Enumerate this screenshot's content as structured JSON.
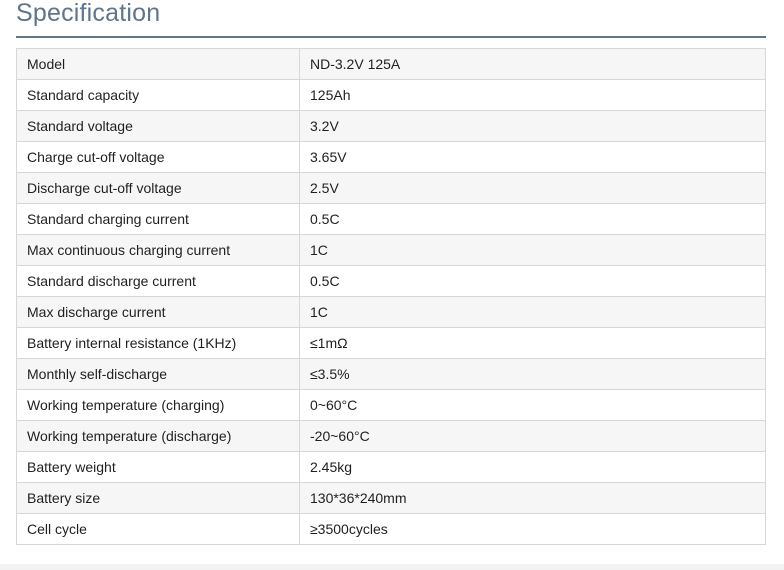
{
  "heading": "Specification",
  "rows": [
    {
      "parameter": "Model",
      "value": "ND-3.2V 125A"
    },
    {
      "parameter": "Standard capacity",
      "value": "125Ah"
    },
    {
      "parameter": "Standard voltage",
      "value": "3.2V"
    },
    {
      "parameter": "Charge cut-off voltage",
      "value": "3.65V"
    },
    {
      "parameter": "Discharge cut-off voltage",
      "value": "2.5V"
    },
    {
      "parameter": "Standard charging current",
      "value": "0.5C"
    },
    {
      "parameter": "Max continuous charging current",
      "value": "1C"
    },
    {
      "parameter": "Standard discharge current",
      "value": "0.5C"
    },
    {
      "parameter": "Max discharge current",
      "value": "1C"
    },
    {
      "parameter": "Battery internal resistance (1KHz)",
      "value": "≤1mΩ"
    },
    {
      "parameter": "Monthly self-discharge",
      "value": "≤3.5%"
    },
    {
      "parameter": "Working temperature (charging)",
      "value": "0~60°C"
    },
    {
      "parameter": "Working temperature (discharge)",
      "value": "-20~60°C"
    },
    {
      "parameter": "Battery weight",
      "value": "2.45kg"
    },
    {
      "parameter": "Battery size",
      "value": "130*36*240mm"
    },
    {
      "parameter": "Cell cycle",
      "value": "≥3500cycles"
    }
  ],
  "colors": {
    "heading": "#5f7589",
    "row_shade": "#f6f6f6",
    "border": "#d7d7d7",
    "text": "#1f1f1f"
  }
}
